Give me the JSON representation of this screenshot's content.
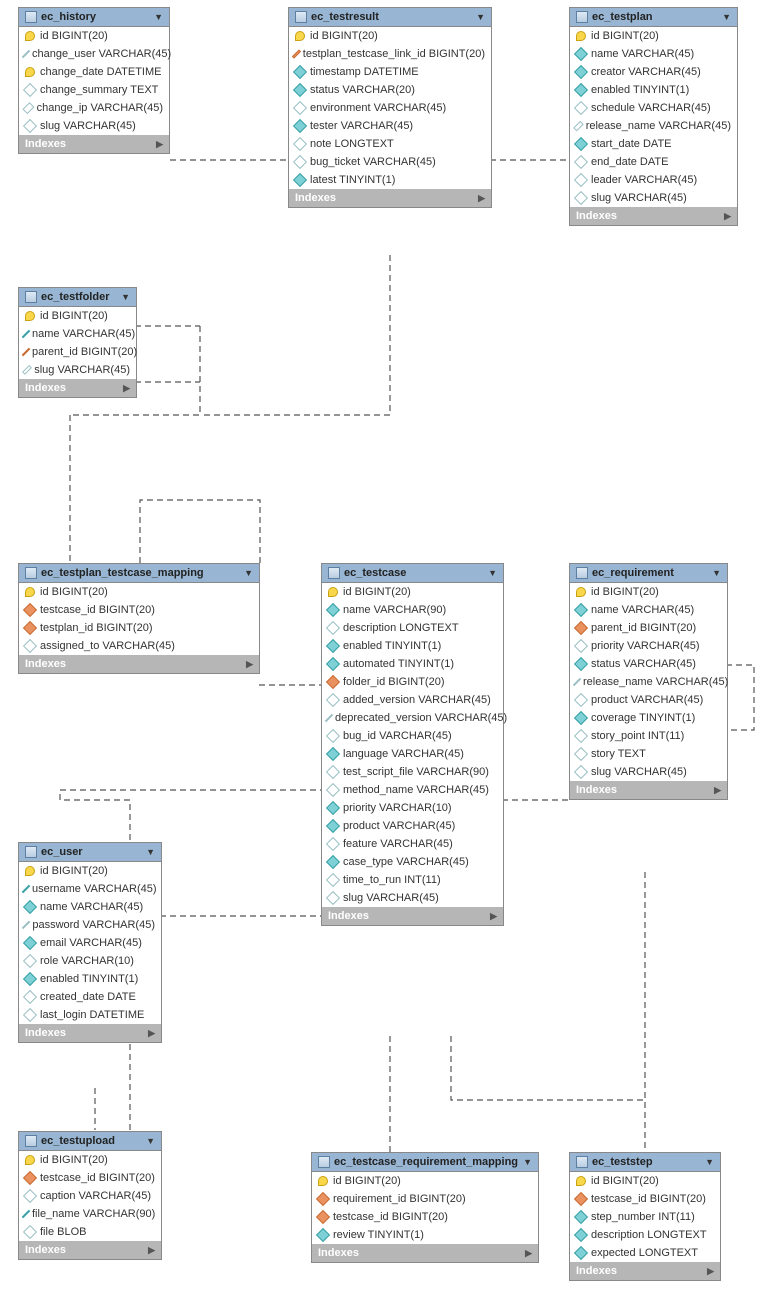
{
  "icon_types": {
    "pk": "primary-key (yellow key)",
    "filled": "filled teal diamond – not null / indexed",
    "open": "open diamond – nullable",
    "fk": "orange diamond – foreign key"
  },
  "indexes_label": "Indexes",
  "relationships_note": "dashed connectors with crow's-foot and bar terminators between tables",
  "tables": {
    "ec_history": {
      "title": "ec_history",
      "cols": [
        {
          "ic": "pk",
          "txt": "id BIGINT(20)"
        },
        {
          "ic": "open",
          "txt": "change_user VARCHAR(45)"
        },
        {
          "ic": "pk",
          "txt": "change_date DATETIME"
        },
        {
          "ic": "open",
          "txt": "change_summary TEXT"
        },
        {
          "ic": "open",
          "txt": "change_ip VARCHAR(45)"
        },
        {
          "ic": "open",
          "txt": "slug VARCHAR(45)"
        }
      ]
    },
    "ec_testresult": {
      "title": "ec_testresult",
      "cols": [
        {
          "ic": "pk",
          "txt": "id BIGINT(20)"
        },
        {
          "ic": "fk",
          "txt": "testplan_testcase_link_id BIGINT(20)"
        },
        {
          "ic": "filled",
          "txt": "timestamp DATETIME"
        },
        {
          "ic": "filled",
          "txt": "status VARCHAR(20)"
        },
        {
          "ic": "open",
          "txt": "environment VARCHAR(45)"
        },
        {
          "ic": "filled",
          "txt": "tester VARCHAR(45)"
        },
        {
          "ic": "open",
          "txt": "note LONGTEXT"
        },
        {
          "ic": "open",
          "txt": "bug_ticket VARCHAR(45)"
        },
        {
          "ic": "filled",
          "txt": "latest TINYINT(1)"
        }
      ]
    },
    "ec_testplan": {
      "title": "ec_testplan",
      "cols": [
        {
          "ic": "pk",
          "txt": "id BIGINT(20)"
        },
        {
          "ic": "filled",
          "txt": "name VARCHAR(45)"
        },
        {
          "ic": "filled",
          "txt": "creator VARCHAR(45)"
        },
        {
          "ic": "filled",
          "txt": "enabled TINYINT(1)"
        },
        {
          "ic": "open",
          "txt": "schedule VARCHAR(45)"
        },
        {
          "ic": "open",
          "txt": "release_name VARCHAR(45)"
        },
        {
          "ic": "filled",
          "txt": "start_date DATE"
        },
        {
          "ic": "open",
          "txt": "end_date DATE"
        },
        {
          "ic": "open",
          "txt": "leader VARCHAR(45)"
        },
        {
          "ic": "open",
          "txt": "slug VARCHAR(45)"
        }
      ]
    },
    "ec_testfolder": {
      "title": "ec_testfolder",
      "cols": [
        {
          "ic": "pk",
          "txt": "id BIGINT(20)"
        },
        {
          "ic": "filled",
          "txt": "name VARCHAR(45)"
        },
        {
          "ic": "fk",
          "txt": "parent_id BIGINT(20)"
        },
        {
          "ic": "open",
          "txt": "slug VARCHAR(45)"
        }
      ]
    },
    "ec_testplan_testcase_mapping": {
      "title": "ec_testplan_testcase_mapping",
      "cols": [
        {
          "ic": "pk",
          "txt": "id BIGINT(20)"
        },
        {
          "ic": "fk",
          "txt": "testcase_id BIGINT(20)"
        },
        {
          "ic": "fk",
          "txt": "testplan_id BIGINT(20)"
        },
        {
          "ic": "open",
          "txt": "assigned_to VARCHAR(45)"
        }
      ]
    },
    "ec_testcase": {
      "title": "ec_testcase",
      "cols": [
        {
          "ic": "pk",
          "txt": "id BIGINT(20)"
        },
        {
          "ic": "filled",
          "txt": "name VARCHAR(90)"
        },
        {
          "ic": "open",
          "txt": "description LONGTEXT"
        },
        {
          "ic": "filled",
          "txt": "enabled TINYINT(1)"
        },
        {
          "ic": "filled",
          "txt": "automated TINYINT(1)"
        },
        {
          "ic": "fk",
          "txt": "folder_id BIGINT(20)"
        },
        {
          "ic": "open",
          "txt": "added_version VARCHAR(45)"
        },
        {
          "ic": "open",
          "txt": "deprecated_version VARCHAR(45)"
        },
        {
          "ic": "open",
          "txt": "bug_id VARCHAR(45)"
        },
        {
          "ic": "filled",
          "txt": "language VARCHAR(45)"
        },
        {
          "ic": "open",
          "txt": "test_script_file VARCHAR(90)"
        },
        {
          "ic": "open",
          "txt": "method_name VARCHAR(45)"
        },
        {
          "ic": "filled",
          "txt": "priority VARCHAR(10)"
        },
        {
          "ic": "filled",
          "txt": "product VARCHAR(45)"
        },
        {
          "ic": "open",
          "txt": "feature VARCHAR(45)"
        },
        {
          "ic": "filled",
          "txt": "case_type VARCHAR(45)"
        },
        {
          "ic": "open",
          "txt": "time_to_run INT(11)"
        },
        {
          "ic": "open",
          "txt": "slug VARCHAR(45)"
        }
      ]
    },
    "ec_requirement": {
      "title": "ec_requirement",
      "cols": [
        {
          "ic": "pk",
          "txt": "id BIGINT(20)"
        },
        {
          "ic": "filled",
          "txt": "name VARCHAR(45)"
        },
        {
          "ic": "fk",
          "txt": "parent_id BIGINT(20)"
        },
        {
          "ic": "open",
          "txt": "priority VARCHAR(45)"
        },
        {
          "ic": "filled",
          "txt": "status VARCHAR(45)"
        },
        {
          "ic": "open",
          "txt": "release_name VARCHAR(45)"
        },
        {
          "ic": "open",
          "txt": "product VARCHAR(45)"
        },
        {
          "ic": "filled",
          "txt": "coverage TINYINT(1)"
        },
        {
          "ic": "open",
          "txt": "story_point INT(11)"
        },
        {
          "ic": "open",
          "txt": "story TEXT"
        },
        {
          "ic": "open",
          "txt": "slug VARCHAR(45)"
        }
      ]
    },
    "ec_user": {
      "title": "ec_user",
      "cols": [
        {
          "ic": "pk",
          "txt": "id BIGINT(20)"
        },
        {
          "ic": "filled",
          "txt": "username VARCHAR(45)"
        },
        {
          "ic": "filled",
          "txt": "name VARCHAR(45)"
        },
        {
          "ic": "open",
          "txt": "password VARCHAR(45)"
        },
        {
          "ic": "filled",
          "txt": "email VARCHAR(45)"
        },
        {
          "ic": "open",
          "txt": "role VARCHAR(10)"
        },
        {
          "ic": "filled",
          "txt": "enabled TINYINT(1)"
        },
        {
          "ic": "open",
          "txt": "created_date DATE"
        },
        {
          "ic": "open",
          "txt": "last_login DATETIME"
        }
      ]
    },
    "ec_testupload": {
      "title": "ec_testupload",
      "cols": [
        {
          "ic": "pk",
          "txt": "id BIGINT(20)"
        },
        {
          "ic": "fk",
          "txt": "testcase_id BIGINT(20)"
        },
        {
          "ic": "open",
          "txt": "caption VARCHAR(45)"
        },
        {
          "ic": "filled",
          "txt": "file_name VARCHAR(90)"
        },
        {
          "ic": "open",
          "txt": "file BLOB"
        }
      ]
    },
    "ec_testcase_requirement_mapping": {
      "title": "ec_testcase_requirement_mapping",
      "cols": [
        {
          "ic": "pk",
          "txt": "id BIGINT(20)"
        },
        {
          "ic": "fk",
          "txt": "requirement_id BIGINT(20)"
        },
        {
          "ic": "fk",
          "txt": "testcase_id BIGINT(20)"
        },
        {
          "ic": "filled",
          "txt": "review TINYINT(1)"
        }
      ]
    },
    "ec_teststep": {
      "title": "ec_teststep",
      "cols": [
        {
          "ic": "pk",
          "txt": "id BIGINT(20)"
        },
        {
          "ic": "fk",
          "txt": "testcase_id BIGINT(20)"
        },
        {
          "ic": "filled",
          "txt": "step_number INT(11)"
        },
        {
          "ic": "filled",
          "txt": "description LONGTEXT"
        },
        {
          "ic": "filled",
          "txt": "expected LONGTEXT"
        }
      ]
    }
  }
}
